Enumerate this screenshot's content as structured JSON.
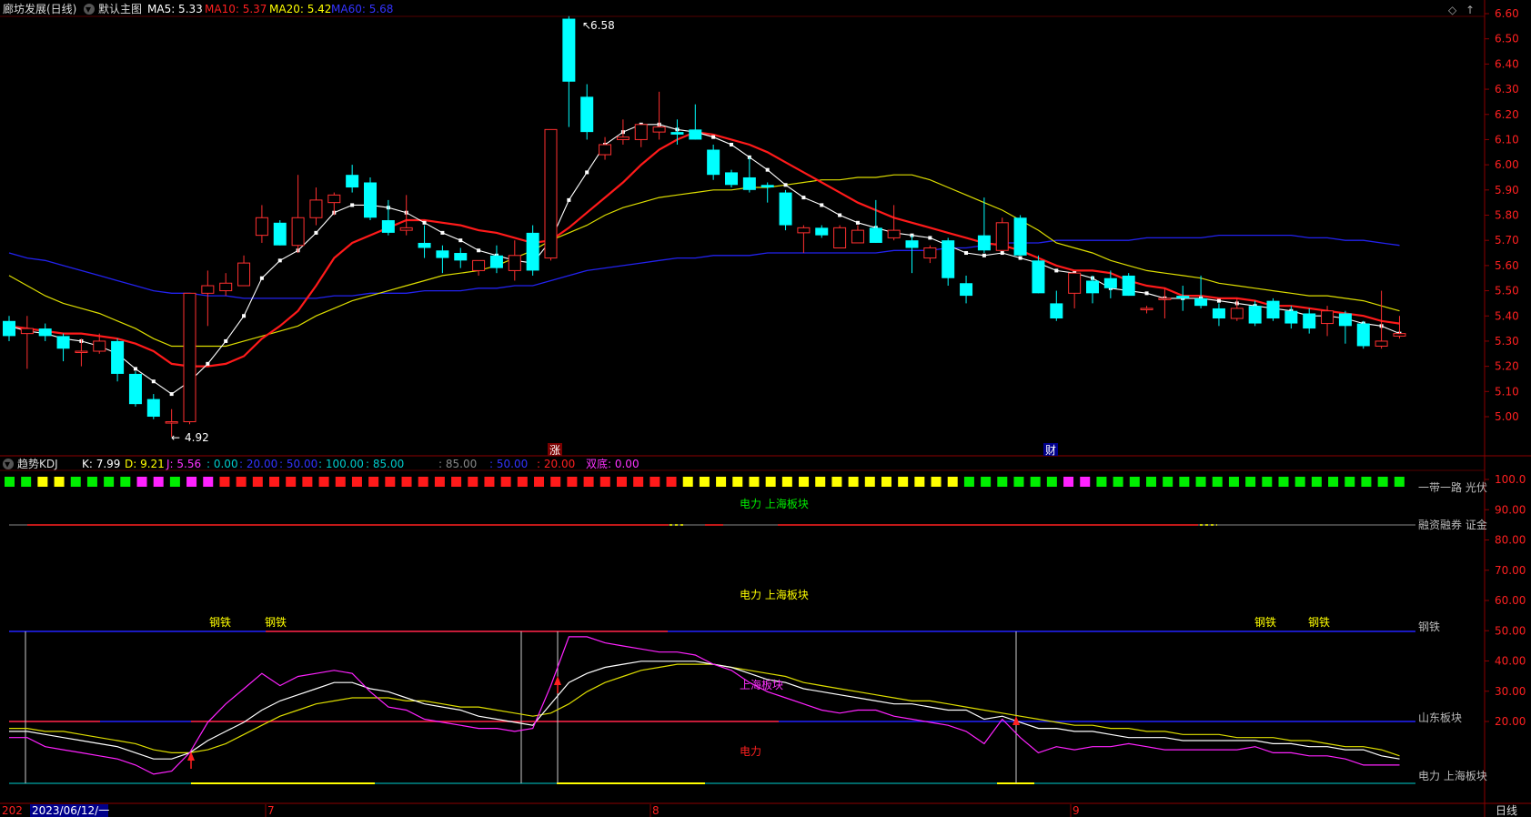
{
  "header": {
    "stock_label": "廊坊发展(日线)",
    "template_label": "默认主图",
    "ma5": "MA5: 5.33",
    "ma10": "MA10: 5.37",
    "ma20": "MA20: 5.42",
    "ma60": "MA60: 5.68"
  },
  "price_axis": {
    "ticks": [
      "6.60",
      "6.50",
      "6.40",
      "6.30",
      "6.20",
      "6.10",
      "6.00",
      "5.90",
      "5.80",
      "5.70",
      "5.60",
      "5.50",
      "5.40",
      "5.30",
      "5.20",
      "5.10",
      "5.00"
    ]
  },
  "main_chart": {
    "high_label": "6.58",
    "low_label": "4.92",
    "markers": [
      "涨",
      "财"
    ]
  },
  "kdj_header": {
    "name": "趋势KDJ",
    "k": "K: 7.99",
    "d": "D: 9.21",
    "j": "J: 5.56",
    "v0": ": 0.00",
    "v20": ": 20.00",
    "v50": ": 50.00",
    "v100": ": 100.00",
    "v85a": ": 85.00",
    "v85b": ": 85.00",
    "v50b": ": 50.00",
    "v20b": ": 20.00",
    "shuangdi": "双底: 0.00"
  },
  "kdj_axis": {
    "ticks": [
      "100.0",
      "90.00",
      "80.00",
      "70.00",
      "60.00",
      "50.00",
      "40.00",
      "30.00",
      "20.00"
    ]
  },
  "kdj_labels": {
    "top_center": "电力 上海板块",
    "mid_center": "电力 上海板块",
    "steel": "钢铁",
    "shanghai": "上海板块",
    "power": "电力",
    "right_1": "一带一路 光伏",
    "right_2": "融资融券 证金",
    "right_3": "钢铁",
    "right_4": "山东板块",
    "right_5": "电力 上海板块"
  },
  "kdj_squares": [
    "green",
    "green",
    "yellow",
    "yellow",
    "green",
    "green",
    "green",
    "green",
    "magenta",
    "magenta",
    "green",
    "magenta",
    "magenta",
    "red",
    "red",
    "red",
    "red",
    "red",
    "red",
    "red",
    "red",
    "red",
    "red",
    "red",
    "red",
    "red",
    "red",
    "red",
    "red",
    "red",
    "red",
    "red",
    "red",
    "red",
    "red",
    "red",
    "red",
    "red",
    "red",
    "red",
    "red",
    "yellow",
    "yellow",
    "yellow",
    "yellow",
    "yellow",
    "yellow",
    "yellow",
    "yellow",
    "yellow",
    "yellow",
    "yellow",
    "yellow",
    "yellow",
    "yellow",
    "yellow",
    "yellow",
    "yellow",
    "green",
    "green",
    "green",
    "green",
    "green",
    "green",
    "magenta",
    "magenta",
    "green",
    "green",
    "green",
    "green",
    "green",
    "green",
    "green",
    "green",
    "green",
    "green",
    "green",
    "green",
    "green",
    "green",
    "green",
    "green",
    "green",
    "green",
    "green"
  ],
  "time_axis": {
    "start_partial": "202",
    "cursor_date": "2023/06/12/一",
    "m7": "7",
    "m8": "8",
    "m9": "9",
    "period": "日线"
  },
  "candles": [
    {
      "o": 5.38,
      "h": 5.4,
      "l": 5.3,
      "c": 5.32
    },
    {
      "o": 5.33,
      "h": 5.4,
      "l": 5.19,
      "c": 5.35
    },
    {
      "o": 5.35,
      "h": 5.37,
      "l": 5.3,
      "c": 5.32
    },
    {
      "o": 5.32,
      "h": 5.33,
      "l": 5.22,
      "c": 5.27
    },
    {
      "o": 5.26,
      "h": 5.31,
      "l": 5.2,
      "c": 5.26
    },
    {
      "o": 5.26,
      "h": 5.33,
      "l": 5.25,
      "c": 5.3
    },
    {
      "o": 5.3,
      "h": 5.31,
      "l": 5.14,
      "c": 5.17
    },
    {
      "o": 5.17,
      "h": 5.18,
      "l": 5.04,
      "c": 5.05
    },
    {
      "o": 5.07,
      "h": 5.09,
      "l": 4.99,
      "c": 5.0
    },
    {
      "o": 4.98,
      "h": 5.03,
      "l": 4.92,
      "c": 4.98
    },
    {
      "o": 4.98,
      "h": 5.49,
      "l": 4.97,
      "c": 5.49
    },
    {
      "o": 5.49,
      "h": 5.58,
      "l": 5.36,
      "c": 5.52
    },
    {
      "o": 5.5,
      "h": 5.57,
      "l": 5.48,
      "c": 5.53
    },
    {
      "o": 5.52,
      "h": 5.64,
      "l": 5.52,
      "c": 5.61
    },
    {
      "o": 5.72,
      "h": 5.84,
      "l": 5.69,
      "c": 5.79
    },
    {
      "o": 5.77,
      "h": 5.78,
      "l": 5.68,
      "c": 5.68
    },
    {
      "o": 5.68,
      "h": 5.96,
      "l": 5.65,
      "c": 5.79
    },
    {
      "o": 5.79,
      "h": 5.91,
      "l": 5.76,
      "c": 5.86
    },
    {
      "o": 5.85,
      "h": 5.89,
      "l": 5.8,
      "c": 5.88
    },
    {
      "o": 5.96,
      "h": 6.0,
      "l": 5.89,
      "c": 5.91
    },
    {
      "o": 5.93,
      "h": 5.95,
      "l": 5.78,
      "c": 5.79
    },
    {
      "o": 5.78,
      "h": 5.86,
      "l": 5.72,
      "c": 5.73
    },
    {
      "o": 5.74,
      "h": 5.88,
      "l": 5.72,
      "c": 5.75
    },
    {
      "o": 5.69,
      "h": 5.76,
      "l": 5.63,
      "c": 5.67
    },
    {
      "o": 5.66,
      "h": 5.68,
      "l": 5.57,
      "c": 5.63
    },
    {
      "o": 5.65,
      "h": 5.67,
      "l": 5.59,
      "c": 5.62
    },
    {
      "o": 5.58,
      "h": 5.61,
      "l": 5.56,
      "c": 5.62
    },
    {
      "o": 5.64,
      "h": 5.68,
      "l": 5.57,
      "c": 5.59
    },
    {
      "o": 5.58,
      "h": 5.7,
      "l": 5.54,
      "c": 5.64
    },
    {
      "o": 5.73,
      "h": 5.76,
      "l": 5.56,
      "c": 5.58
    },
    {
      "o": 5.63,
      "h": 6.14,
      "l": 5.62,
      "c": 6.14
    },
    {
      "o": 6.58,
      "h": 6.59,
      "l": 6.15,
      "c": 6.33
    },
    {
      "o": 6.27,
      "h": 6.32,
      "l": 6.1,
      "c": 6.13
    },
    {
      "o": 6.04,
      "h": 6.11,
      "l": 6.02,
      "c": 6.08
    },
    {
      "o": 6.1,
      "h": 6.18,
      "l": 6.08,
      "c": 6.11
    },
    {
      "o": 6.1,
      "h": 6.15,
      "l": 6.07,
      "c": 6.16
    },
    {
      "o": 6.13,
      "h": 6.29,
      "l": 6.1,
      "c": 6.15
    },
    {
      "o": 6.13,
      "h": 6.18,
      "l": 6.08,
      "c": 6.12
    },
    {
      "o": 6.14,
      "h": 6.24,
      "l": 6.1,
      "c": 6.1
    },
    {
      "o": 6.06,
      "h": 6.08,
      "l": 5.94,
      "c": 5.96
    },
    {
      "o": 5.97,
      "h": 5.98,
      "l": 5.91,
      "c": 5.92
    },
    {
      "o": 5.95,
      "h": 6.03,
      "l": 5.89,
      "c": 5.9
    },
    {
      "o": 5.92,
      "h": 5.93,
      "l": 5.85,
      "c": 5.91
    },
    {
      "o": 5.89,
      "h": 5.9,
      "l": 5.74,
      "c": 5.76
    },
    {
      "o": 5.73,
      "h": 5.76,
      "l": 5.65,
      "c": 5.75
    },
    {
      "o": 5.75,
      "h": 5.76,
      "l": 5.71,
      "c": 5.72
    },
    {
      "o": 5.67,
      "h": 5.76,
      "l": 5.67,
      "c": 5.75
    },
    {
      "o": 5.69,
      "h": 5.76,
      "l": 5.69,
      "c": 5.74
    },
    {
      "o": 5.75,
      "h": 5.86,
      "l": 5.69,
      "c": 5.69
    },
    {
      "o": 5.71,
      "h": 5.84,
      "l": 5.7,
      "c": 5.74
    },
    {
      "o": 5.7,
      "h": 5.72,
      "l": 5.57,
      "c": 5.67
    },
    {
      "o": 5.63,
      "h": 5.68,
      "l": 5.61,
      "c": 5.67
    },
    {
      "o": 5.7,
      "h": 5.71,
      "l": 5.52,
      "c": 5.55
    },
    {
      "o": 5.53,
      "h": 5.56,
      "l": 5.45,
      "c": 5.48
    },
    {
      "o": 5.72,
      "h": 5.87,
      "l": 5.65,
      "c": 5.66
    },
    {
      "o": 5.66,
      "h": 5.79,
      "l": 5.66,
      "c": 5.77
    },
    {
      "o": 5.79,
      "h": 5.8,
      "l": 5.64,
      "c": 5.64
    },
    {
      "o": 5.62,
      "h": 5.64,
      "l": 5.49,
      "c": 5.49
    },
    {
      "o": 5.45,
      "h": 5.5,
      "l": 5.38,
      "c": 5.39
    },
    {
      "o": 5.49,
      "h": 5.57,
      "l": 5.43,
      "c": 5.57
    },
    {
      "o": 5.54,
      "h": 5.56,
      "l": 5.45,
      "c": 5.49
    },
    {
      "o": 5.55,
      "h": 5.58,
      "l": 5.47,
      "c": 5.51
    },
    {
      "o": 5.56,
      "h": 5.57,
      "l": 5.48,
      "c": 5.48
    },
    {
      "o": 5.43,
      "h": 5.44,
      "l": 5.41,
      "c": 5.43
    },
    {
      "o": 5.47,
      "h": 5.51,
      "l": 5.39,
      "c": 5.47
    },
    {
      "o": 5.48,
      "h": 5.52,
      "l": 5.42,
      "c": 5.47
    },
    {
      "o": 5.47,
      "h": 5.56,
      "l": 5.43,
      "c": 5.44
    },
    {
      "o": 5.43,
      "h": 5.45,
      "l": 5.36,
      "c": 5.39
    },
    {
      "o": 5.39,
      "h": 5.47,
      "l": 5.38,
      "c": 5.43
    },
    {
      "o": 5.44,
      "h": 5.46,
      "l": 5.36,
      "c": 5.37
    },
    {
      "o": 5.46,
      "h": 5.47,
      "l": 5.38,
      "c": 5.39
    },
    {
      "o": 5.42,
      "h": 5.44,
      "l": 5.35,
      "c": 5.37
    },
    {
      "o": 5.41,
      "h": 5.43,
      "l": 5.33,
      "c": 5.35
    },
    {
      "o": 5.37,
      "h": 5.44,
      "l": 5.32,
      "c": 5.42
    },
    {
      "o": 5.41,
      "h": 5.42,
      "l": 5.29,
      "c": 5.36
    },
    {
      "o": 5.37,
      "h": 5.38,
      "l": 5.27,
      "c": 5.28
    },
    {
      "o": 5.28,
      "h": 5.5,
      "l": 5.27,
      "c": 5.3
    },
    {
      "o": 5.32,
      "h": 5.4,
      "l": 5.31,
      "c": 5.33
    }
  ],
  "ma_lines": {
    "ma5": [
      5.36,
      5.34,
      5.33,
      5.31,
      5.3,
      5.28,
      5.25,
      5.19,
      5.14,
      5.09,
      5.14,
      5.21,
      5.3,
      5.4,
      5.55,
      5.62,
      5.66,
      5.73,
      5.81,
      5.84,
      5.84,
      5.83,
      5.81,
      5.77,
      5.73,
      5.7,
      5.66,
      5.64,
      5.62,
      5.61,
      5.7,
      5.86,
      5.97,
      6.08,
      6.13,
      6.16,
      6.16,
      6.14,
      6.13,
      6.11,
      6.08,
      6.03,
      5.98,
      5.92,
      5.87,
      5.84,
      5.8,
      5.77,
      5.75,
      5.73,
      5.72,
      5.71,
      5.68,
      5.65,
      5.64,
      5.65,
      5.63,
      5.61,
      5.58,
      5.57,
      5.55,
      5.51,
      5.5,
      5.49,
      5.47,
      5.47,
      5.47,
      5.46,
      5.45,
      5.44,
      5.43,
      5.42,
      5.4,
      5.4,
      5.39,
      5.37,
      5.36,
      5.33
    ],
    "ma10": [
      5.36,
      5.35,
      5.34,
      5.33,
      5.33,
      5.32,
      5.31,
      5.29,
      5.26,
      5.21,
      5.2,
      5.2,
      5.21,
      5.24,
      5.31,
      5.36,
      5.42,
      5.52,
      5.63,
      5.69,
      5.72,
      5.75,
      5.78,
      5.78,
      5.77,
      5.76,
      5.74,
      5.73,
      5.71,
      5.69,
      5.7,
      5.75,
      5.81,
      5.87,
      5.93,
      6.0,
      6.06,
      6.1,
      6.13,
      6.12,
      6.1,
      6.08,
      6.05,
      6.01,
      5.97,
      5.93,
      5.89,
      5.85,
      5.82,
      5.79,
      5.77,
      5.75,
      5.73,
      5.71,
      5.69,
      5.68,
      5.66,
      5.63,
      5.6,
      5.58,
      5.58,
      5.57,
      5.54,
      5.52,
      5.51,
      5.48,
      5.48,
      5.47,
      5.47,
      5.46,
      5.44,
      5.44,
      5.43,
      5.42,
      5.41,
      5.4,
      5.38,
      5.37
    ],
    "ma20": [
      5.56,
      5.52,
      5.48,
      5.45,
      5.43,
      5.41,
      5.38,
      5.35,
      5.31,
      5.28,
      5.28,
      5.28,
      5.28,
      5.3,
      5.32,
      5.34,
      5.36,
      5.4,
      5.43,
      5.46,
      5.48,
      5.5,
      5.52,
      5.54,
      5.56,
      5.57,
      5.58,
      5.6,
      5.63,
      5.66,
      5.7,
      5.73,
      5.76,
      5.8,
      5.83,
      5.85,
      5.87,
      5.88,
      5.89,
      5.9,
      5.9,
      5.91,
      5.91,
      5.92,
      5.93,
      5.94,
      5.94,
      5.95,
      5.95,
      5.96,
      5.96,
      5.94,
      5.91,
      5.88,
      5.85,
      5.82,
      5.78,
      5.74,
      5.69,
      5.67,
      5.65,
      5.62,
      5.6,
      5.58,
      5.57,
      5.56,
      5.55,
      5.53,
      5.52,
      5.51,
      5.5,
      5.49,
      5.48,
      5.48,
      5.47,
      5.46,
      5.44,
      5.42
    ],
    "ma60": [
      5.65,
      5.63,
      5.62,
      5.6,
      5.58,
      5.56,
      5.54,
      5.52,
      5.5,
      5.49,
      5.49,
      5.48,
      5.48,
      5.47,
      5.47,
      5.47,
      5.47,
      5.47,
      5.48,
      5.48,
      5.49,
      5.49,
      5.49,
      5.5,
      5.5,
      5.5,
      5.51,
      5.51,
      5.52,
      5.52,
      5.54,
      5.56,
      5.58,
      5.59,
      5.6,
      5.61,
      5.62,
      5.63,
      5.63,
      5.64,
      5.64,
      5.64,
      5.65,
      5.65,
      5.65,
      5.65,
      5.65,
      5.65,
      5.65,
      5.66,
      5.66,
      5.66,
      5.67,
      5.67,
      5.68,
      5.69,
      5.69,
      5.69,
      5.7,
      5.7,
      5.7,
      5.7,
      5.7,
      5.71,
      5.71,
      5.71,
      5.71,
      5.72,
      5.72,
      5.72,
      5.72,
      5.72,
      5.71,
      5.71,
      5.7,
      5.7,
      5.69,
      5.68
    ]
  },
  "kdj_lines": {
    "k": [
      17,
      17,
      16,
      15,
      14,
      13,
      12,
      10,
      8,
      8,
      10,
      14,
      17,
      20,
      24,
      27,
      29,
      31,
      33,
      33,
      31,
      30,
      28,
      26,
      25,
      24,
      22,
      21,
      20,
      19,
      26,
      33,
      36,
      38,
      39,
      40,
      40,
      40,
      40,
      39,
      38,
      36,
      34,
      33,
      31,
      30,
      29,
      28,
      27,
      26,
      26,
      25,
      24,
      24,
      21,
      22,
      20,
      18,
      18,
      17,
      17,
      16,
      15,
      15,
      15,
      14,
      14,
      14,
      14,
      14,
      13,
      13,
      12,
      12,
      11,
      11,
      9,
      8
    ],
    "d": [
      18,
      18,
      17,
      17,
      16,
      15,
      14,
      13,
      11,
      10,
      10,
      11,
      13,
      16,
      19,
      22,
      24,
      26,
      27,
      28,
      28,
      28,
      27,
      27,
      26,
      25,
      25,
      24,
      23,
      22,
      23,
      26,
      30,
      33,
      35,
      37,
      38,
      39,
      39,
      39,
      38,
      37,
      36,
      35,
      33,
      32,
      31,
      30,
      29,
      28,
      27,
      27,
      26,
      25,
      24,
      23,
      22,
      21,
      20,
      19,
      19,
      18,
      18,
      17,
      17,
      16,
      16,
      16,
      15,
      15,
      15,
      14,
      14,
      13,
      12,
      12,
      11,
      9
    ],
    "j": [
      15,
      15,
      12,
      11,
      10,
      9,
      8,
      6,
      3,
      4,
      10,
      20,
      26,
      31,
      36,
      32,
      35,
      36,
      37,
      36,
      30,
      25,
      24,
      21,
      20,
      19,
      18,
      18,
      17,
      18,
      32,
      48,
      48,
      46,
      45,
      44,
      43,
      43,
      42,
      39,
      37,
      33,
      30,
      28,
      26,
      24,
      23,
      24,
      24,
      22,
      21,
      20,
      19,
      17,
      13,
      21,
      15,
      10,
      12,
      11,
      12,
      12,
      13,
      12,
      11,
      11,
      11,
      11,
      11,
      12,
      10,
      10,
      9,
      9,
      8,
      6,
      6,
      6
    ]
  }
}
